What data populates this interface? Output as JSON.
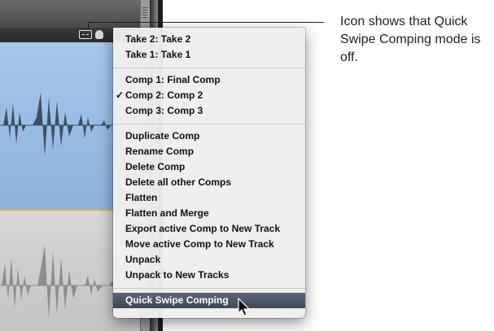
{
  "annotation": {
    "text": "Icon shows that Quick Swipe Comping mode is off."
  },
  "region_header": {
    "swipe_icon": "quick-swipe-comping-off-icon",
    "take_icon": "take-folder-icon"
  },
  "menu": {
    "groups": [
      {
        "items": [
          {
            "label": "Take 2: Take 2"
          },
          {
            "label": "Take 1: Take 1"
          }
        ]
      },
      {
        "items": [
          {
            "label": "Comp 1: Final Comp",
            "checked": false
          },
          {
            "label": "Comp 2: Comp 2",
            "checked": true,
            "check_glyph": "✓"
          },
          {
            "label": "Comp 3: Comp 3",
            "checked": false
          }
        ]
      },
      {
        "items": [
          {
            "label": "Duplicate Comp"
          },
          {
            "label": "Rename Comp"
          },
          {
            "label": "Delete Comp"
          },
          {
            "label": "Delete all other Comps"
          },
          {
            "label": "Flatten"
          },
          {
            "label": "Flatten and Merge"
          },
          {
            "label": "Export active Comp to New Track"
          },
          {
            "label": "Move active Comp to New Track"
          },
          {
            "label": "Unpack"
          },
          {
            "label": "Unpack to New Tracks"
          }
        ]
      },
      {
        "items": [
          {
            "label": "Quick Swipe Comping",
            "highlighted": true
          }
        ]
      }
    ]
  },
  "colors": {
    "active_region": "#a7c6ea",
    "region_border": "#d9b73b",
    "menu_highlight": "#4a5363"
  }
}
